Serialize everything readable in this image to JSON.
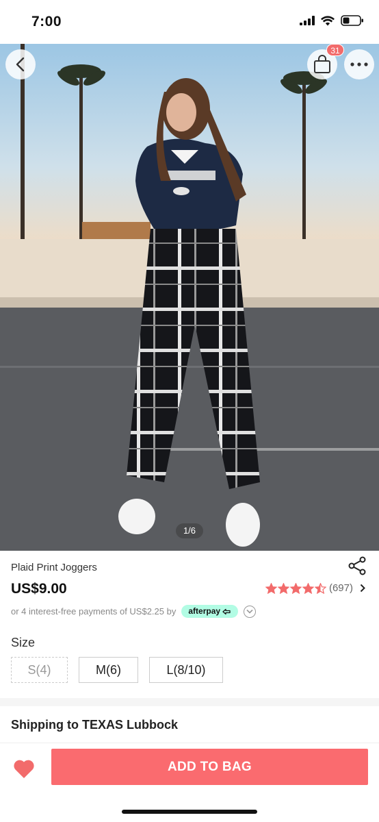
{
  "status_bar": {
    "time": "7:00",
    "icons": [
      "cellular-signal-icon",
      "wifi-icon",
      "battery-icon"
    ]
  },
  "hero": {
    "image_alt": "model wearing plaid joggers",
    "cart_count": "31",
    "page_indicator": "1/6",
    "icons": [
      "back-chevron-icon",
      "shopping-bag-icon",
      "more-dots-icon"
    ]
  },
  "product": {
    "name": "Plaid Print Joggers",
    "price": "US$9.00",
    "rating_stars": 4.5,
    "rating_count": "(697)",
    "installment_text": "or 4 interest-free payments of US$2.25 by",
    "afterpay_label": "afterpay"
  },
  "size": {
    "label": "Size",
    "options": [
      {
        "label": "S(4)",
        "available": false
      },
      {
        "label": "M(6)",
        "available": true
      },
      {
        "label": "L(8/10)",
        "available": true
      }
    ]
  },
  "shipping": {
    "text": "Shipping to TEXAS Lubbock"
  },
  "actions": {
    "add_to_bag": "ADD TO BAG"
  },
  "colors": {
    "accent": "#fa6b6f",
    "star": "#f26b6b",
    "afterpay": "#b2fce4"
  }
}
